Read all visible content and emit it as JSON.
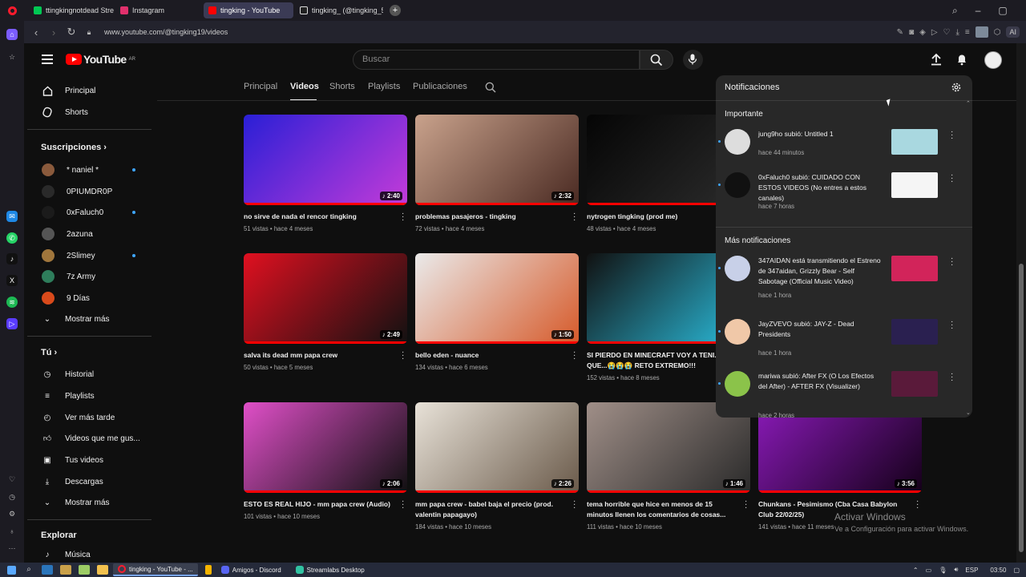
{
  "browser": {
    "tabs": [
      {
        "label": "ttingkingnotdead Stream",
        "color": "#00c853"
      },
      {
        "label": "Instagram",
        "color": "#e1306c"
      },
      {
        "label": "tingking - YouTube",
        "color": "#ff0000",
        "active": true
      },
      {
        "label": "tingking_ (@tingking_5) | ",
        "color": "#ffffff"
      }
    ],
    "url": "www.youtube.com/@tingking19/videos",
    "ai_label": "AI"
  },
  "youtube": {
    "logo_text": "YouTube",
    "country": "AR",
    "search_placeholder": "Buscar"
  },
  "sidebar": {
    "main": [
      {
        "label": "Principal",
        "icon": "home-icon"
      },
      {
        "label": "Shorts",
        "icon": "shorts-icon"
      }
    ],
    "subs_heading": "Suscripciones",
    "subs": [
      {
        "label": "* naniel *",
        "color": "#8a5a3c",
        "new": true
      },
      {
        "label": "0PIUMDR0P",
        "color": "#2a2a2a",
        "new": false
      },
      {
        "label": "0xFaluch0",
        "color": "#1b1b1b",
        "new": true
      },
      {
        "label": "2azuna",
        "color": "#555555",
        "new": false
      },
      {
        "label": "2Slimey",
        "color": "#a0763c",
        "new": true
      },
      {
        "label": "7z Army",
        "color": "#2e7d5b",
        "new": false
      },
      {
        "label": "9 Días",
        "color": "#d84a1b",
        "new": false
      }
    ],
    "more_subs": "Mostrar más",
    "you_heading": "Tú",
    "you": [
      {
        "label": "Historial",
        "icon": "history-icon"
      },
      {
        "label": "Playlists",
        "icon": "playlists-icon"
      },
      {
        "label": "Ver más tarde",
        "icon": "watch-later-icon"
      },
      {
        "label": "Videos que me gus...",
        "icon": "like-icon"
      },
      {
        "label": "Tus videos",
        "icon": "your-videos-icon"
      },
      {
        "label": "Descargas",
        "icon": "download-icon"
      }
    ],
    "more_you": "Mostrar más",
    "explore_heading": "Explorar",
    "explore": [
      {
        "label": "Música",
        "icon": "music-icon"
      }
    ]
  },
  "channel_tabs": [
    "Principal",
    "Videos",
    "Shorts",
    "Playlists",
    "Publicaciones"
  ],
  "videos": [
    {
      "title": "no sirve de nada el rencor tingking",
      "meta": "51 vistas • hace 4 meses",
      "duration": "2:40",
      "thumb": [
        "#2a1fd6",
        "#c33bd9"
      ]
    },
    {
      "title": "problemas pasajeros - tingking",
      "meta": "72 vistas • hace 4 meses",
      "duration": "2:32",
      "thumb": [
        "#c9a28c",
        "#4a2a22"
      ]
    },
    {
      "title": "nytrogen tingking (prod me)",
      "meta": "48 vistas • hace 4 meses",
      "duration": "",
      "thumb": [
        "#050505",
        "#2c2c2c"
      ]
    },
    {
      "title": "salva its dead mm papa crew",
      "meta": "50 vistas • hace 5 meses",
      "duration": "2:49",
      "thumb": [
        "#e01020",
        "#111111"
      ]
    },
    {
      "title": "bello eden - nuance",
      "meta": "134 vistas • hace 6 meses",
      "duration": "1:50",
      "thumb": [
        "#eaeaea",
        "#d65a2a"
      ]
    },
    {
      "title": "SI PIERDO EN MINECRAFT VOY A TENI... QUE...😭😭😭 RETO EXTREMO!!!",
      "meta": "152 vistas • hace 8 meses",
      "duration": "",
      "thumb": [
        "#111111",
        "#2bc0e0"
      ]
    },
    {
      "title": "ESTO ES REAL HIJO - mm papa crew (Audio)",
      "meta": "101 vistas • hace 10 meses",
      "duration": "2:06",
      "thumb": [
        "#e04fc8",
        "#101010"
      ]
    },
    {
      "title": "mm papa crew - babel baja el precio (prod. valentin papagayo)",
      "meta": "184 vistas • hace 10 meses",
      "duration": "2:26",
      "thumb": [
        "#e8e2d8",
        "#6a5a4a"
      ]
    },
    {
      "title": "tema horrible que hice en menos de 15 minutos llenen los comentarios de cosas...",
      "meta": "111 vistas • hace 10 meses",
      "duration": "1:46",
      "thumb": [
        "#a08f88",
        "#2a2a2a"
      ]
    },
    {
      "title": "Chunkans - Pesimismo (Cba Casa Babylon Club 22/02/25)",
      "meta": "141 vistas • hace 11 meses",
      "duration": "3:56",
      "thumb": [
        "#8a1ab8",
        "#140018"
      ]
    }
  ],
  "notifications": {
    "title": "Notificaciones",
    "important_heading": "Importante",
    "more_heading": "Más notificaciones",
    "important": [
      {
        "text": "jung9ho subió: Untitled 1",
        "time": "hace 44 minutos",
        "avatar": "#ddd",
        "thumb": "#a9d8e0"
      },
      {
        "text": "0xFaluch0 subió: CUIDADO CON ESTOS VIDEOS (No entres a estos canales)",
        "time": "hace 7 horas",
        "avatar": "#111",
        "thumb": "#f5f5f5"
      }
    ],
    "more": [
      {
        "text": "347AIDAN está transmitiendo el Estreno de 347aidan, Grizzly Bear - Self Sabotage (Official Music Video)",
        "time": "hace 1 hora",
        "avatar": "#c8d0e8",
        "thumb": "#d2245a"
      },
      {
        "text": "JayZVEVO subió: JAY-Z - Dead Presidents",
        "time": "hace 1 hora",
        "avatar": "#f0c8a8",
        "thumb": "#2a2050"
      },
      {
        "text": "mariwa subió: After FX (O Los Efectos del After) - AFTER FX (Visualizer)",
        "time": "hace 2 horas",
        "avatar": "#8bc34a",
        "thumb": "#5a1a3a"
      }
    ]
  },
  "watermark": {
    "line1": "Activar Windows",
    "line2": "Ve a Configuración para activar Windows."
  },
  "taskbar": {
    "apps": [
      {
        "label": "tingking - YouTube - ...",
        "color": "#ff1b2d",
        "active": true
      },
      {
        "label": "Amigos - Discord",
        "color": "#5865f2",
        "active": false
      },
      {
        "label": "Streamlabs Desktop",
        "color": "#31c3a2",
        "active": false
      }
    ],
    "lang": "ESP",
    "time": "03:50"
  }
}
